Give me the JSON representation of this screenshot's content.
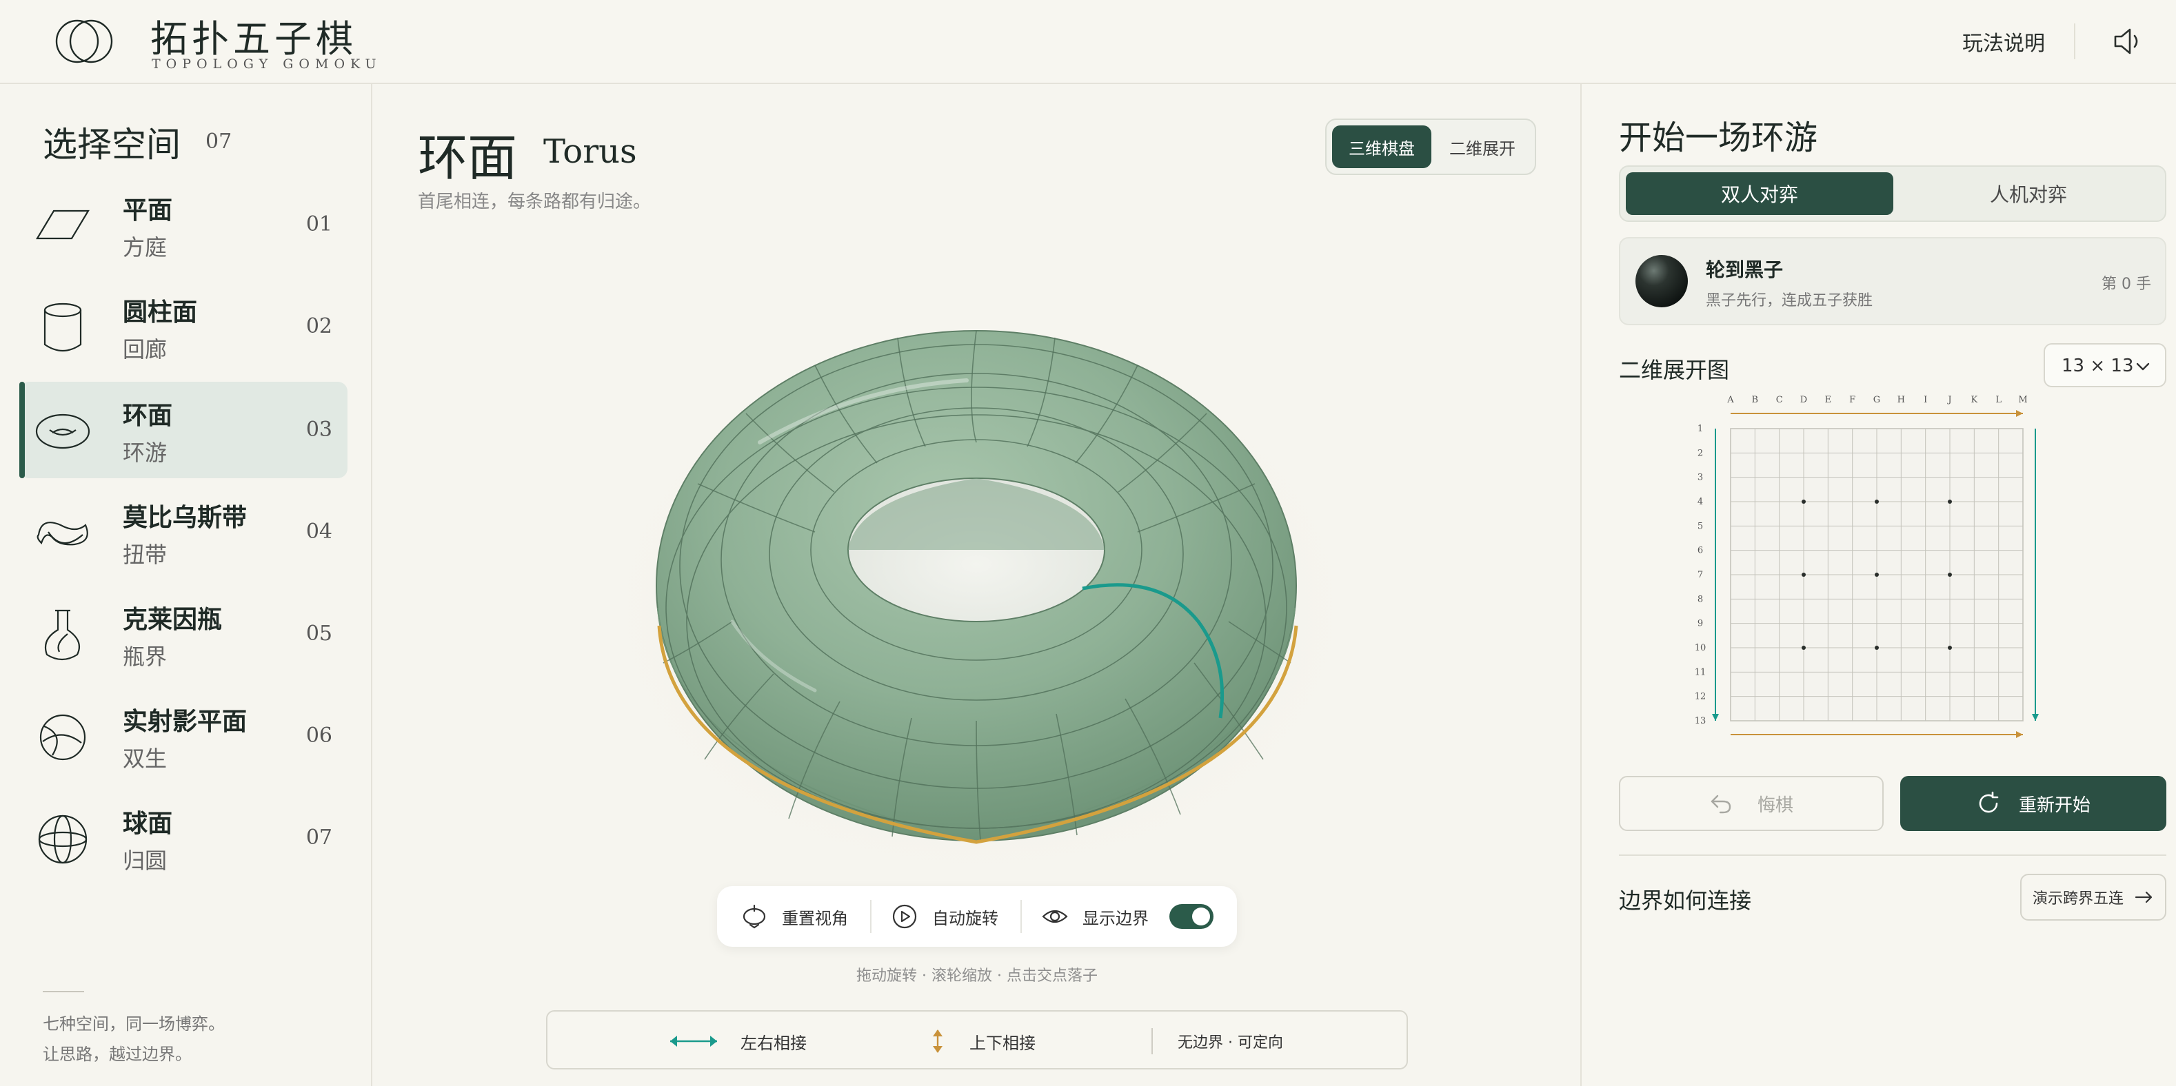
{
  "header": {
    "title": "拓扑五子棋",
    "subtitle": "TOPOLOGY GOMOKU",
    "help_label": "玩法说明",
    "sound_icon": "speaker-icon"
  },
  "sidebar": {
    "title": "选择空间",
    "count": "07",
    "items": [
      {
        "name": "平面",
        "sub": "方庭",
        "num": "01",
        "icon": "plane-icon"
      },
      {
        "name": "圆柱面",
        "sub": "回廊",
        "num": "02",
        "icon": "cylinder-icon"
      },
      {
        "name": "环面",
        "sub": "环游",
        "num": "03",
        "icon": "torus-icon",
        "active": true
      },
      {
        "name": "莫比乌斯带",
        "sub": "扭带",
        "num": "04",
        "icon": "mobius-icon"
      },
      {
        "name": "克莱因瓶",
        "sub": "瓶界",
        "num": "05",
        "icon": "klein-bottle-icon"
      },
      {
        "name": "实射影平面",
        "sub": "双生",
        "num": "06",
        "icon": "projective-plane-icon"
      },
      {
        "name": "球面",
        "sub": "归圆",
        "num": "07",
        "icon": "sphere-icon"
      }
    ],
    "footer_line1": "七种空间，同一场博弈。",
    "footer_line2": "让思路，越过边界。"
  },
  "center": {
    "title": "环面",
    "title_en": "Torus",
    "motto": "首尾相连，每条路都有归途。",
    "view_options": [
      "三维棋盘",
      "二维展开"
    ],
    "active_view": "三维棋盘",
    "controls": {
      "reset_label": "重置视角",
      "auto_rotate_label": "自动旋转",
      "show_border_label": "显示边界",
      "show_border_on": true
    },
    "hint": "拖动旋转 · 滚轮缩放 · 点击交点落子",
    "legend": {
      "lr_label": "左右相接",
      "tb_label": "上下相接",
      "orient_label": "无边界 · 可定向"
    },
    "colors": {
      "torus_green": "#8fb196",
      "seam_teal": "#1a9a8c",
      "seam_gold": "#d3a23e"
    }
  },
  "panel": {
    "title": "开始一场环游",
    "modes": [
      "双人对弈",
      "人机对弈"
    ],
    "active_mode": "双人对弈",
    "turn_title": "轮到黑子",
    "turn_sub": "黑子先行，连成五子获胜",
    "move_count": "第 0 手",
    "map_title": "二维展开图",
    "board_size": "13 × 13",
    "columns": [
      "A",
      "B",
      "C",
      "D",
      "E",
      "F",
      "G",
      "H",
      "I",
      "J",
      "K",
      "L",
      "M"
    ],
    "rows": [
      "1",
      "2",
      "3",
      "4",
      "5",
      "6",
      "7",
      "8",
      "9",
      "10",
      "11",
      "12",
      "13"
    ],
    "undo_label": "悔棋",
    "restart_label": "重新开始",
    "edge_title": "边界如何连接",
    "demo_label": "演示跨界五连",
    "colors": {
      "primary": "#2b4f43",
      "accent_gold": "#c9923a",
      "accent_teal": "#1a9a8c"
    }
  }
}
